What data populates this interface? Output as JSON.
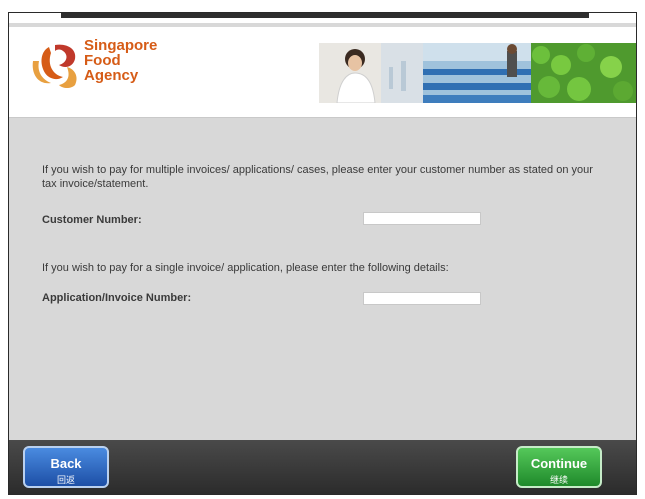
{
  "brand": {
    "line1": "Singapore",
    "line2": "Food",
    "line3": "Agency",
    "accent": "#d65c17"
  },
  "content": {
    "multi_instruction": "If you wish to pay for multiple invoices/ applications/ cases, please enter your customer number as stated on your tax invoice/statement.",
    "customer_label": "Customer Number:",
    "customer_value": "",
    "single_instruction": "If you wish to pay for a single invoice/ application, please enter the following details:",
    "application_label": "Application/Invoice Number:",
    "application_value": ""
  },
  "footer": {
    "back_label": "Back",
    "back_sublabel": "回返",
    "continue_label": "Continue",
    "continue_sublabel": "继续"
  },
  "colors": {
    "back_button": "#1d4fa6",
    "continue_button": "#1f8a2b",
    "footer_bg": "#2b2b2b",
    "content_bg": "#d8d8d8"
  }
}
